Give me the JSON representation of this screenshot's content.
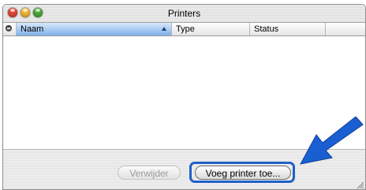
{
  "window": {
    "title": "Printers"
  },
  "table": {
    "columns": [
      {
        "label": "Naam",
        "sorted": true
      },
      {
        "label": "Type"
      },
      {
        "label": "Status"
      }
    ],
    "rows": []
  },
  "buttons": {
    "delete_label": "Verwijder",
    "add_printer_label": "Voeg printer toe..."
  },
  "colors": {
    "close": "#e0463b",
    "minimize": "#f2b632",
    "zoom": "#4ba83a",
    "highlight": "#1f61c8",
    "sorted_header": "#7fb0ea"
  },
  "icons": [
    "close-button",
    "minimize-button",
    "zoom-button",
    "status-icon",
    "sort-ascending-icon",
    "resize-grip-icon",
    "pointer-arrow-icon"
  ]
}
